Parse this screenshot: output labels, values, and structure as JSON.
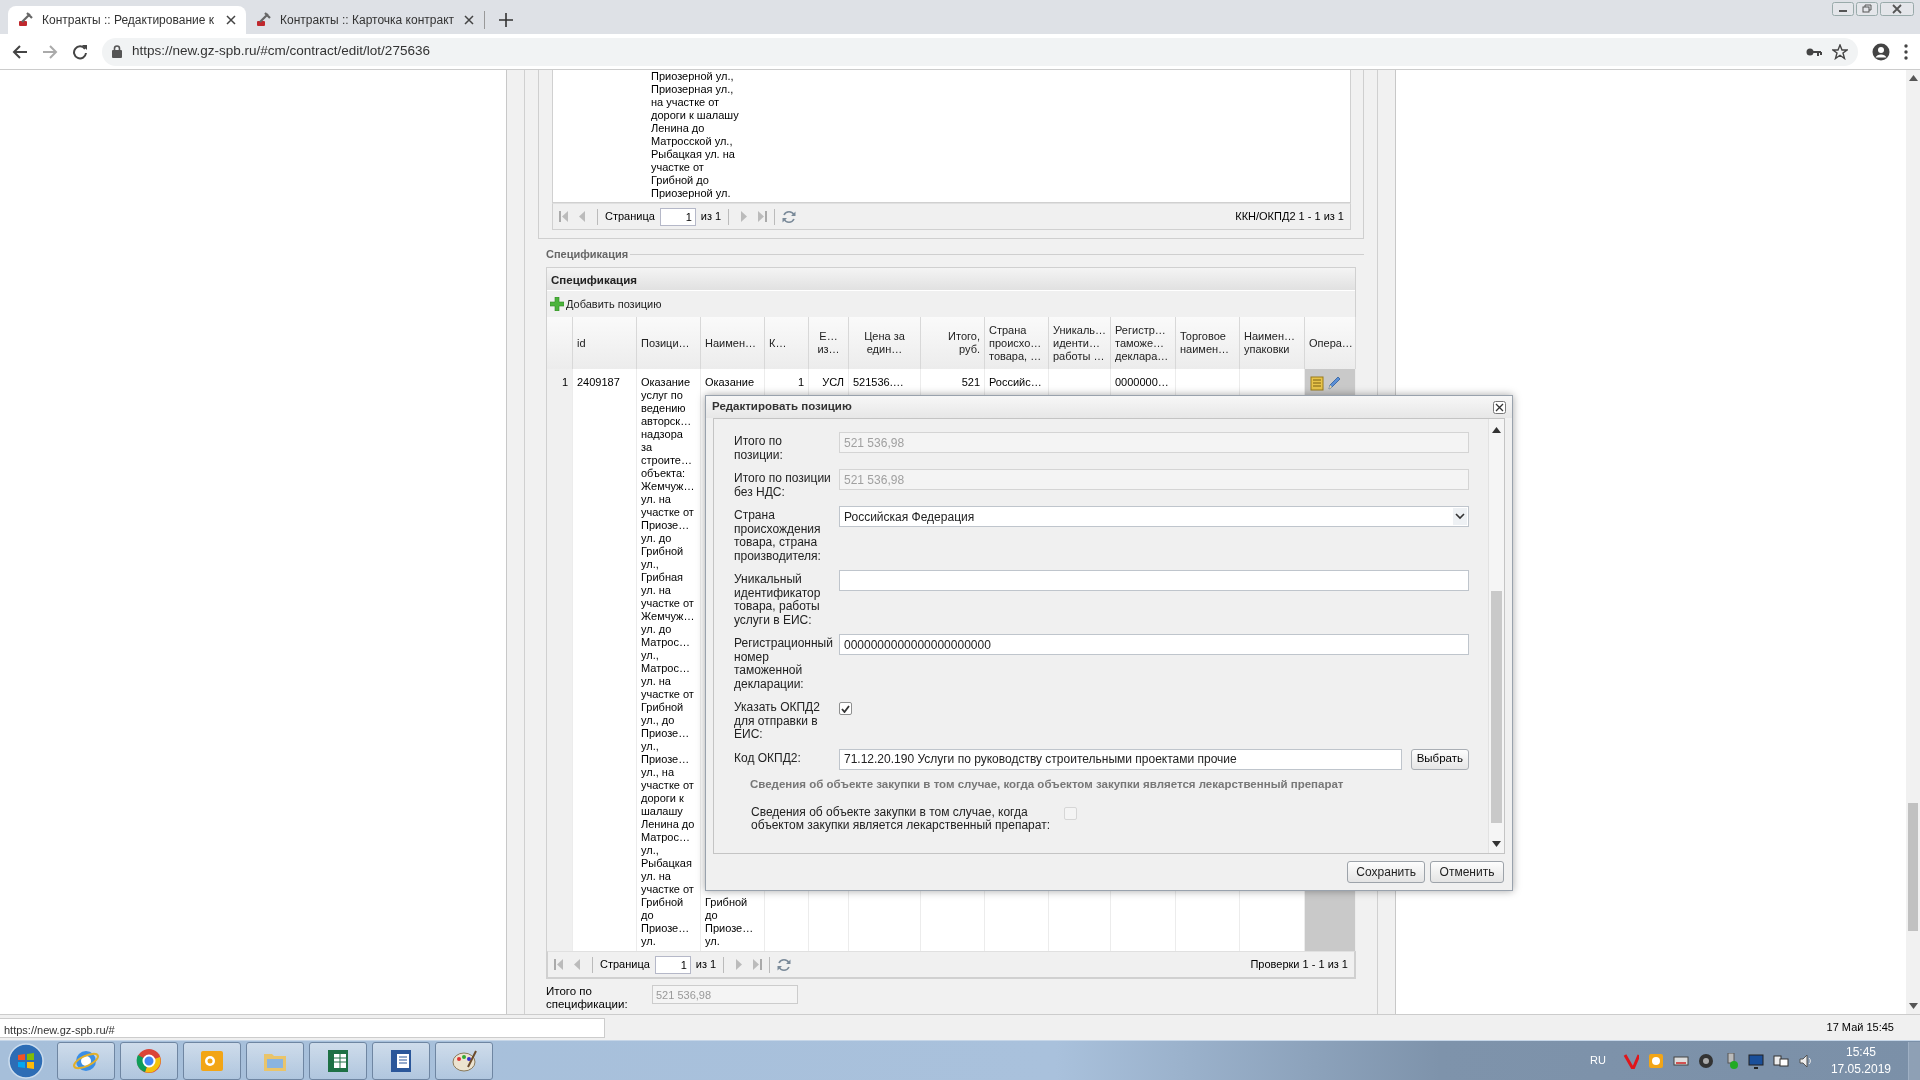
{
  "browser": {
    "tabs": [
      {
        "title": "Контракты :: Редактирование к",
        "selected": true
      },
      {
        "title": "Контракты :: Карточка контракт",
        "selected": false
      }
    ],
    "url": "https://new.gz-spb.ru/#cm/contract/edit/lot/275636",
    "status_url": "https://new.gz-spb.ru/#"
  },
  "classifier_grid": {
    "cell_lines": [
      "Приозерной ул.,",
      "Приозерная ул.,",
      "на участке от",
      "дороги к шалашу",
      "Ленина до",
      "Матросской ул.,",
      "Рыбацкая ул. на",
      "участке от",
      "Грибной до",
      "Приозерной ул."
    ],
    "pager": {
      "page_label": "Страница",
      "page": "1",
      "page_count": "из 1",
      "summary": "ККН/ОКПД2 1 - 1 из 1"
    }
  },
  "specification": {
    "legend": "Спецификация",
    "title": "Спецификация",
    "add_button": "Добавить позицию",
    "columns": [
      {
        "lines": [
          "id"
        ],
        "kind": "text"
      },
      {
        "lines": [
          "Позици…"
        ],
        "kind": "text"
      },
      {
        "lines": [
          "Наимен…"
        ],
        "kind": "text"
      },
      {
        "lines": [
          "К…"
        ],
        "kind": "text"
      },
      {
        "lines": [
          "Е…",
          "из…"
        ],
        "kind": "short"
      },
      {
        "lines": [
          "Цена за",
          "един…"
        ],
        "kind": "short"
      },
      {
        "lines": [
          "Итого,",
          "руб."
        ],
        "kind": "number"
      },
      {
        "lines": [
          "Страна",
          "происхо…",
          "товара, …"
        ],
        "kind": "text"
      },
      {
        "lines": [
          "Уникаль…",
          "иденти…",
          "работы …"
        ],
        "kind": "text"
      },
      {
        "lines": [
          "Регистр…",
          "таможе…",
          "деклара…"
        ],
        "kind": "text"
      },
      {
        "lines": [
          "Торговое",
          "наимен…"
        ],
        "kind": "text"
      },
      {
        "lines": [
          "Наимен…",
          "упаковки"
        ],
        "kind": "text"
      },
      {
        "lines": [
          "Опера…"
        ],
        "kind": "text"
      }
    ],
    "rows": [
      {
        "number": "1",
        "cells": [
          {
            "kind": "text",
            "lines": [
              "2409187"
            ]
          },
          {
            "kind": "text",
            "lines": [
              "Оказание",
              "услуг по",
              "ведению",
              "авторск…",
              "надзора",
              "за",
              "строите…",
              "объекта:",
              "Жемчуж…",
              "ул. на",
              "участке от",
              "Приозе…",
              "ул. до",
              "Грибной",
              "ул.,",
              "Грибная",
              "ул. на",
              "участке от",
              "Жемчуж…",
              "ул. до",
              "Матрос…",
              "ул.,",
              "Матрос…",
              "ул. на",
              "участке от",
              "Грибной",
              "ул., до",
              "Приозе…",
              "ул.,",
              "Приозе…",
              "ул., на",
              "участке от",
              "дороги к",
              "шалашу",
              "Ленина до",
              "Матрос…",
              "ул.,",
              "Рыбацкая",
              "ул. на",
              "участке от",
              "Грибной",
              "до",
              "Приозе…",
              "ул."
            ]
          },
          {
            "kind": "text",
            "lines": [
              "Оказание"
            ],
            "bottom_lines": [
              "Грибной",
              "до",
              "Приозе…",
              "ул."
            ]
          },
          {
            "kind": "number",
            "lines": [
              "1"
            ]
          },
          {
            "kind": "number",
            "lines": [
              "УСЛ"
            ]
          },
          {
            "kind": "text",
            "lines": [
              "521536.…"
            ]
          },
          {
            "kind": "number",
            "lines": [
              "521"
            ]
          },
          {
            "kind": "text",
            "lines": [
              "Российс…"
            ]
          },
          {
            "kind": "empty"
          },
          {
            "kind": "text",
            "lines": [
              "0000000…"
            ]
          },
          {
            "kind": "empty"
          },
          {
            "kind": "empty"
          },
          {
            "kind": "actions"
          }
        ]
      }
    ],
    "pager": {
      "page_label": "Страница",
      "page": "1",
      "page_count": "из 1",
      "summary": "Проверки 1 - 1 из 1"
    },
    "total": {
      "label": "Итого по спецификации:",
      "value": "521 536,98",
      "disabled": true
    }
  },
  "dialog": {
    "title": "Редактировать позицию",
    "fields": [
      {
        "kind": "text",
        "label": "Итого по позиции:",
        "value": "521 536,98",
        "disabled": true
      },
      {
        "kind": "text",
        "label": "Итого по позиции без НДС:",
        "value": "521 536,98",
        "disabled": true
      },
      {
        "kind": "select",
        "label": "Страна происхождения товара, страна производителя:",
        "value": "Российская Федерация",
        "disabled": false
      },
      {
        "kind": "text",
        "label": "Уникальный идентификатор товара, работы услуги в ЕИС:",
        "disabled": false
      },
      {
        "kind": "text",
        "label": "Регистрационный номер таможенной декларации:",
        "value": "0000000000000000000000",
        "disabled": false
      },
      {
        "kind": "checkbox",
        "label": "Указать ОКПД2 для отправки в ЕИС:",
        "checked": true,
        "disabled": false
      },
      {
        "kind": "picker",
        "label": "Код ОКПД2:",
        "value": "71.12.20.190 Услуги по руководству строительными проектами прочие",
        "button": "Выбрать"
      },
      {
        "kind": "section",
        "text": "Сведения об объекте закупки в том случае, когда объектом закупки является лекарственный препарат"
      },
      {
        "kind": "wide_checkbox",
        "label": "Сведения об объекте закупки в том случае, когда объектом закупки является лекарственный препарат:",
        "checked": false,
        "disabled": true
      }
    ],
    "buttons": [
      "Сохранить",
      "Отменить"
    ]
  },
  "page_footer": {
    "datetime": "17 Май 15:45"
  },
  "taskbar": {
    "language": "RU",
    "time": "15:45",
    "date": "17.05.2019"
  }
}
